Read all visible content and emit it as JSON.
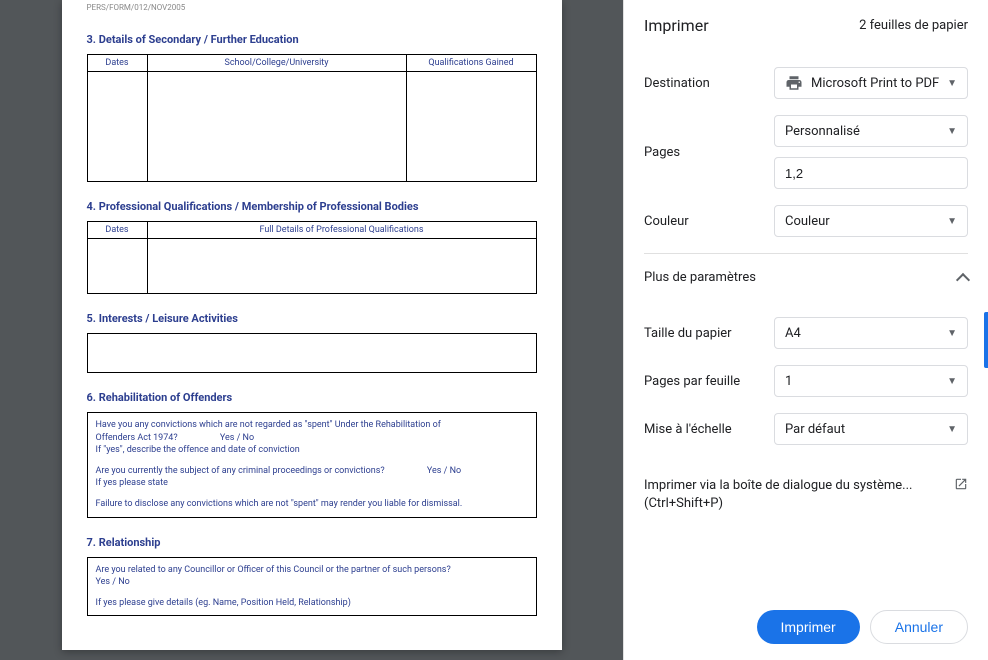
{
  "document": {
    "form_header": "PERS/FORM/012/NOV2005",
    "section3": {
      "title": "3.  Details of Secondary / Further Education",
      "headers": {
        "dates": "Dates",
        "school": "School/College/University",
        "quals": "Qualifications Gained"
      }
    },
    "section4": {
      "title": "4.  Professional Qualifications / Membership of Professional Bodies",
      "headers": {
        "dates": "Dates",
        "details": "Full Details of Professional Qualifications"
      }
    },
    "section5": {
      "title": "5.  Interests / Leisure Activities"
    },
    "section6": {
      "title": "6.  Rehabilitation of Offenders",
      "line1": "Have you any convictions which are not regarded as \"spent\" Under the Rehabilitation of",
      "line2a": "Offenders Act 1974?",
      "line2b": "Yes / No",
      "line3": "If \"yes\", describe the offence and date of conviction",
      "line4a": "Are you currently the subject of any criminal proceedings or convictions?",
      "line4b": "Yes / No",
      "line5": "If yes please state",
      "line6": "Failure to disclose any convictions which are not \"spent\" may render you liable for dismissal."
    },
    "section7": {
      "title": "7.  Relationship",
      "line1": "Are you related to any Councillor or Officer of this Council or the partner of such persons?",
      "line2": "Yes / No",
      "line3": "If yes please give details (eg. Name, Position Held, Relationship)"
    }
  },
  "print": {
    "title": "Imprimer",
    "sheets": "2 feuilles de papier",
    "destination": {
      "label": "Destination",
      "value": "Microsoft Print to PDF"
    },
    "pages": {
      "label": "Pages",
      "value": "Personnalisé",
      "input_value": "1,2"
    },
    "color": {
      "label": "Couleur",
      "value": "Couleur"
    },
    "more_settings": "Plus de paramètres",
    "paper_size": {
      "label": "Taille du papier",
      "value": "A4"
    },
    "pages_per_sheet": {
      "label": "Pages par feuille",
      "value": "1"
    },
    "scale": {
      "label": "Mise à l'échelle",
      "value": "Par défaut"
    },
    "system_dialog": {
      "line1": "Imprimer via la boîte de dialogue du système...",
      "line2": "(Ctrl+Shift+P)"
    },
    "buttons": {
      "print": "Imprimer",
      "cancel": "Annuler"
    }
  }
}
